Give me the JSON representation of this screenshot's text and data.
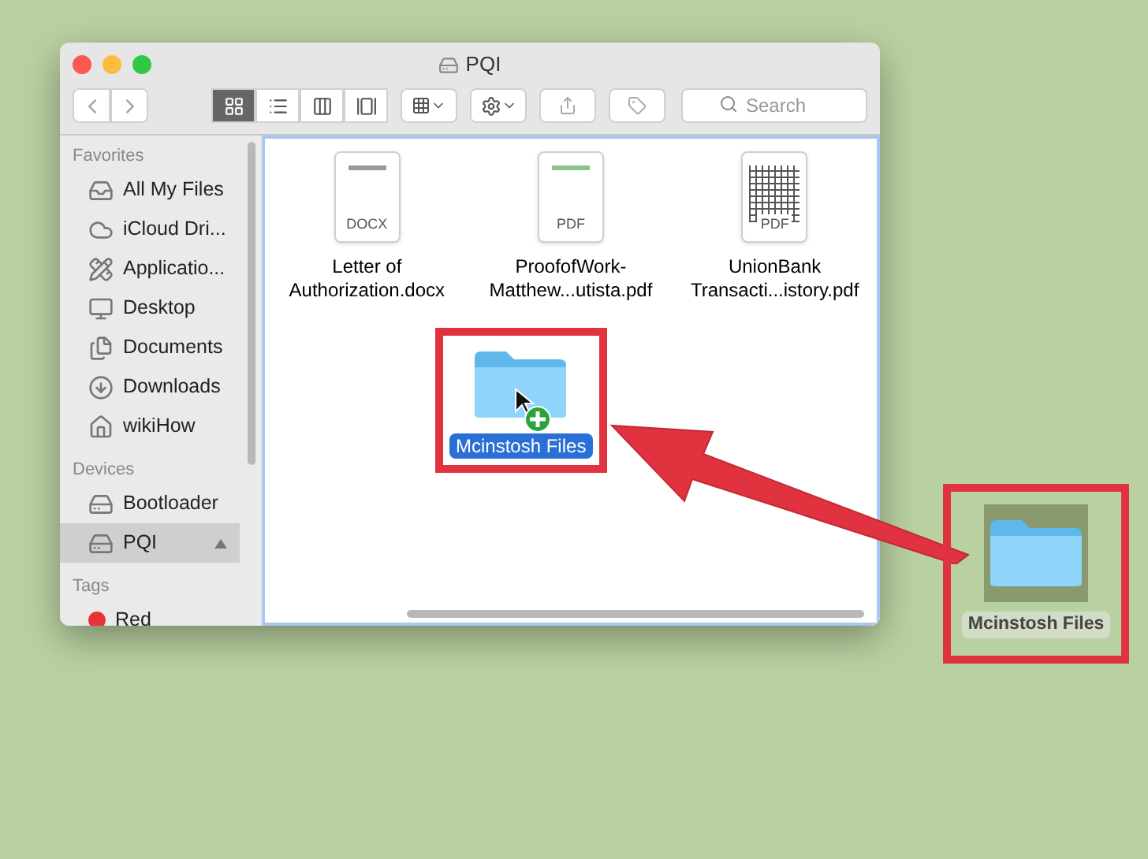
{
  "window": {
    "title": "PQI"
  },
  "toolbar": {
    "view_buttons": [
      {
        "kind": "icons",
        "selected": true
      },
      {
        "kind": "list",
        "selected": false
      },
      {
        "kind": "columns",
        "selected": false
      },
      {
        "kind": "gallery",
        "selected": false
      }
    ],
    "search": {
      "placeholder": "Search"
    }
  },
  "sidebar": {
    "sections": [
      {
        "title": "Favorites",
        "items": [
          {
            "kind": "allfiles",
            "label": "All My Files",
            "selected": false
          },
          {
            "kind": "cloud",
            "label": "iCloud Dri...",
            "selected": false
          },
          {
            "kind": "apps",
            "label": "Applicatio...",
            "selected": false
          },
          {
            "kind": "desktop",
            "label": "Desktop",
            "selected": false
          },
          {
            "kind": "documents",
            "label": "Documents",
            "selected": false
          },
          {
            "kind": "downloads",
            "label": "Downloads",
            "selected": false
          },
          {
            "kind": "home",
            "label": "wikiHow",
            "selected": false
          }
        ]
      },
      {
        "title": "Devices",
        "items": [
          {
            "kind": "drive",
            "label": "Bootloader",
            "selected": false
          },
          {
            "kind": "drive",
            "label": "PQI",
            "selected": true,
            "eject": true
          }
        ]
      },
      {
        "title": "Tags",
        "items": [
          {
            "kind": "tag",
            "label": "Red",
            "selected": false,
            "color": "#e8333b"
          }
        ]
      }
    ]
  },
  "files": [
    {
      "kind": "doc",
      "badge": "DOCX",
      "name": "Letter of Authorization.docx",
      "selected": false
    },
    {
      "kind": "doc",
      "badge": "PDF",
      "name": "ProofofWork-Matthew...utista.pdf",
      "selected": false
    },
    {
      "kind": "sheet",
      "badge": "PDF",
      "name": "UnionBank Transacti...istory.pdf",
      "selected": false
    },
    {
      "kind": "folder",
      "name": "Mcinstosh Files",
      "selected": true,
      "highlighted": true,
      "drop_copy": true
    }
  ],
  "desktop_item": {
    "name": "Mcinstosh Files",
    "highlighted": true
  }
}
